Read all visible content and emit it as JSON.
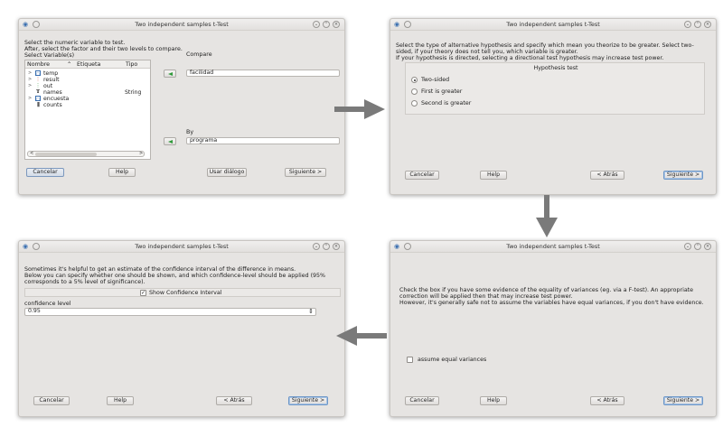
{
  "window_title": "Two independent samples t-Test",
  "buttons": {
    "cancel": "Cancelar",
    "help": "Help",
    "use_dialog": "Usar diálogo",
    "next": "Siguiente >",
    "back": "< Atrás"
  },
  "step1": {
    "intro_1": "Select the numeric variable to test.",
    "intro_2": "After, select the factor and their two levels to compare.",
    "select_label": "Select Variable(s)",
    "columns": [
      "Nombre",
      "Etiqueta",
      "Tipo"
    ],
    "variables": [
      {
        "name": "temp",
        "type": "",
        "icon": "factor-icon",
        "expand": ">"
      },
      {
        "name": "result",
        "type": "",
        "icon": "colored-dots-icon",
        "expand": ">"
      },
      {
        "name": "out",
        "type": "",
        "icon": "colored-dots-icon",
        "expand": ">"
      },
      {
        "name": "names",
        "type": "String",
        "icon": "string-icon",
        "expand": ""
      },
      {
        "name": "encuesta",
        "type": "",
        "icon": "factor-icon",
        "expand": ">"
      },
      {
        "name": "counts",
        "type": "",
        "icon": "numeric-icon",
        "expand": ""
      }
    ],
    "compare_label": "Compare",
    "compare_value": "facilidad",
    "by_label": "By",
    "by_value": "programa"
  },
  "step2": {
    "intro_1": "Select the type of alternative hypothesis and specify which mean you theorize to be greater. Select two-",
    "intro_2": "sided, if your theory does not tell you, which variable is greater.",
    "intro_3": "If your hypothesis is directed, selecting a directional test hypothesis may increase test power.",
    "group_title": "Hypothesis test",
    "options": [
      "Two-sided",
      "First is greater",
      "Second is greater"
    ],
    "selected": "Two-sided"
  },
  "step3": {
    "intro_1": "Check the box if you have some evidence of the equality of variances (eg. via a F-test). An appropriate",
    "intro_2": "correction will be applied then that may increase test power.",
    "intro_3": "However, it's generally safe not to assume the variables have equal variances, if you don't have evidence.",
    "checkbox_label": "assume equal variances",
    "checked": false
  },
  "step4": {
    "intro_1": "Sometimes it's helpful to get an estimate of the confidence interval of the difference in means.",
    "intro_2": "Below you can specify whether one should be shown, and which confidence-level should be applied (95%",
    "intro_3": "corresponds to a 5% level of significance).",
    "checkbox_label": "Show Confidence Interval",
    "checked": true,
    "level_label": "confidence level",
    "level_value": "0.95"
  }
}
